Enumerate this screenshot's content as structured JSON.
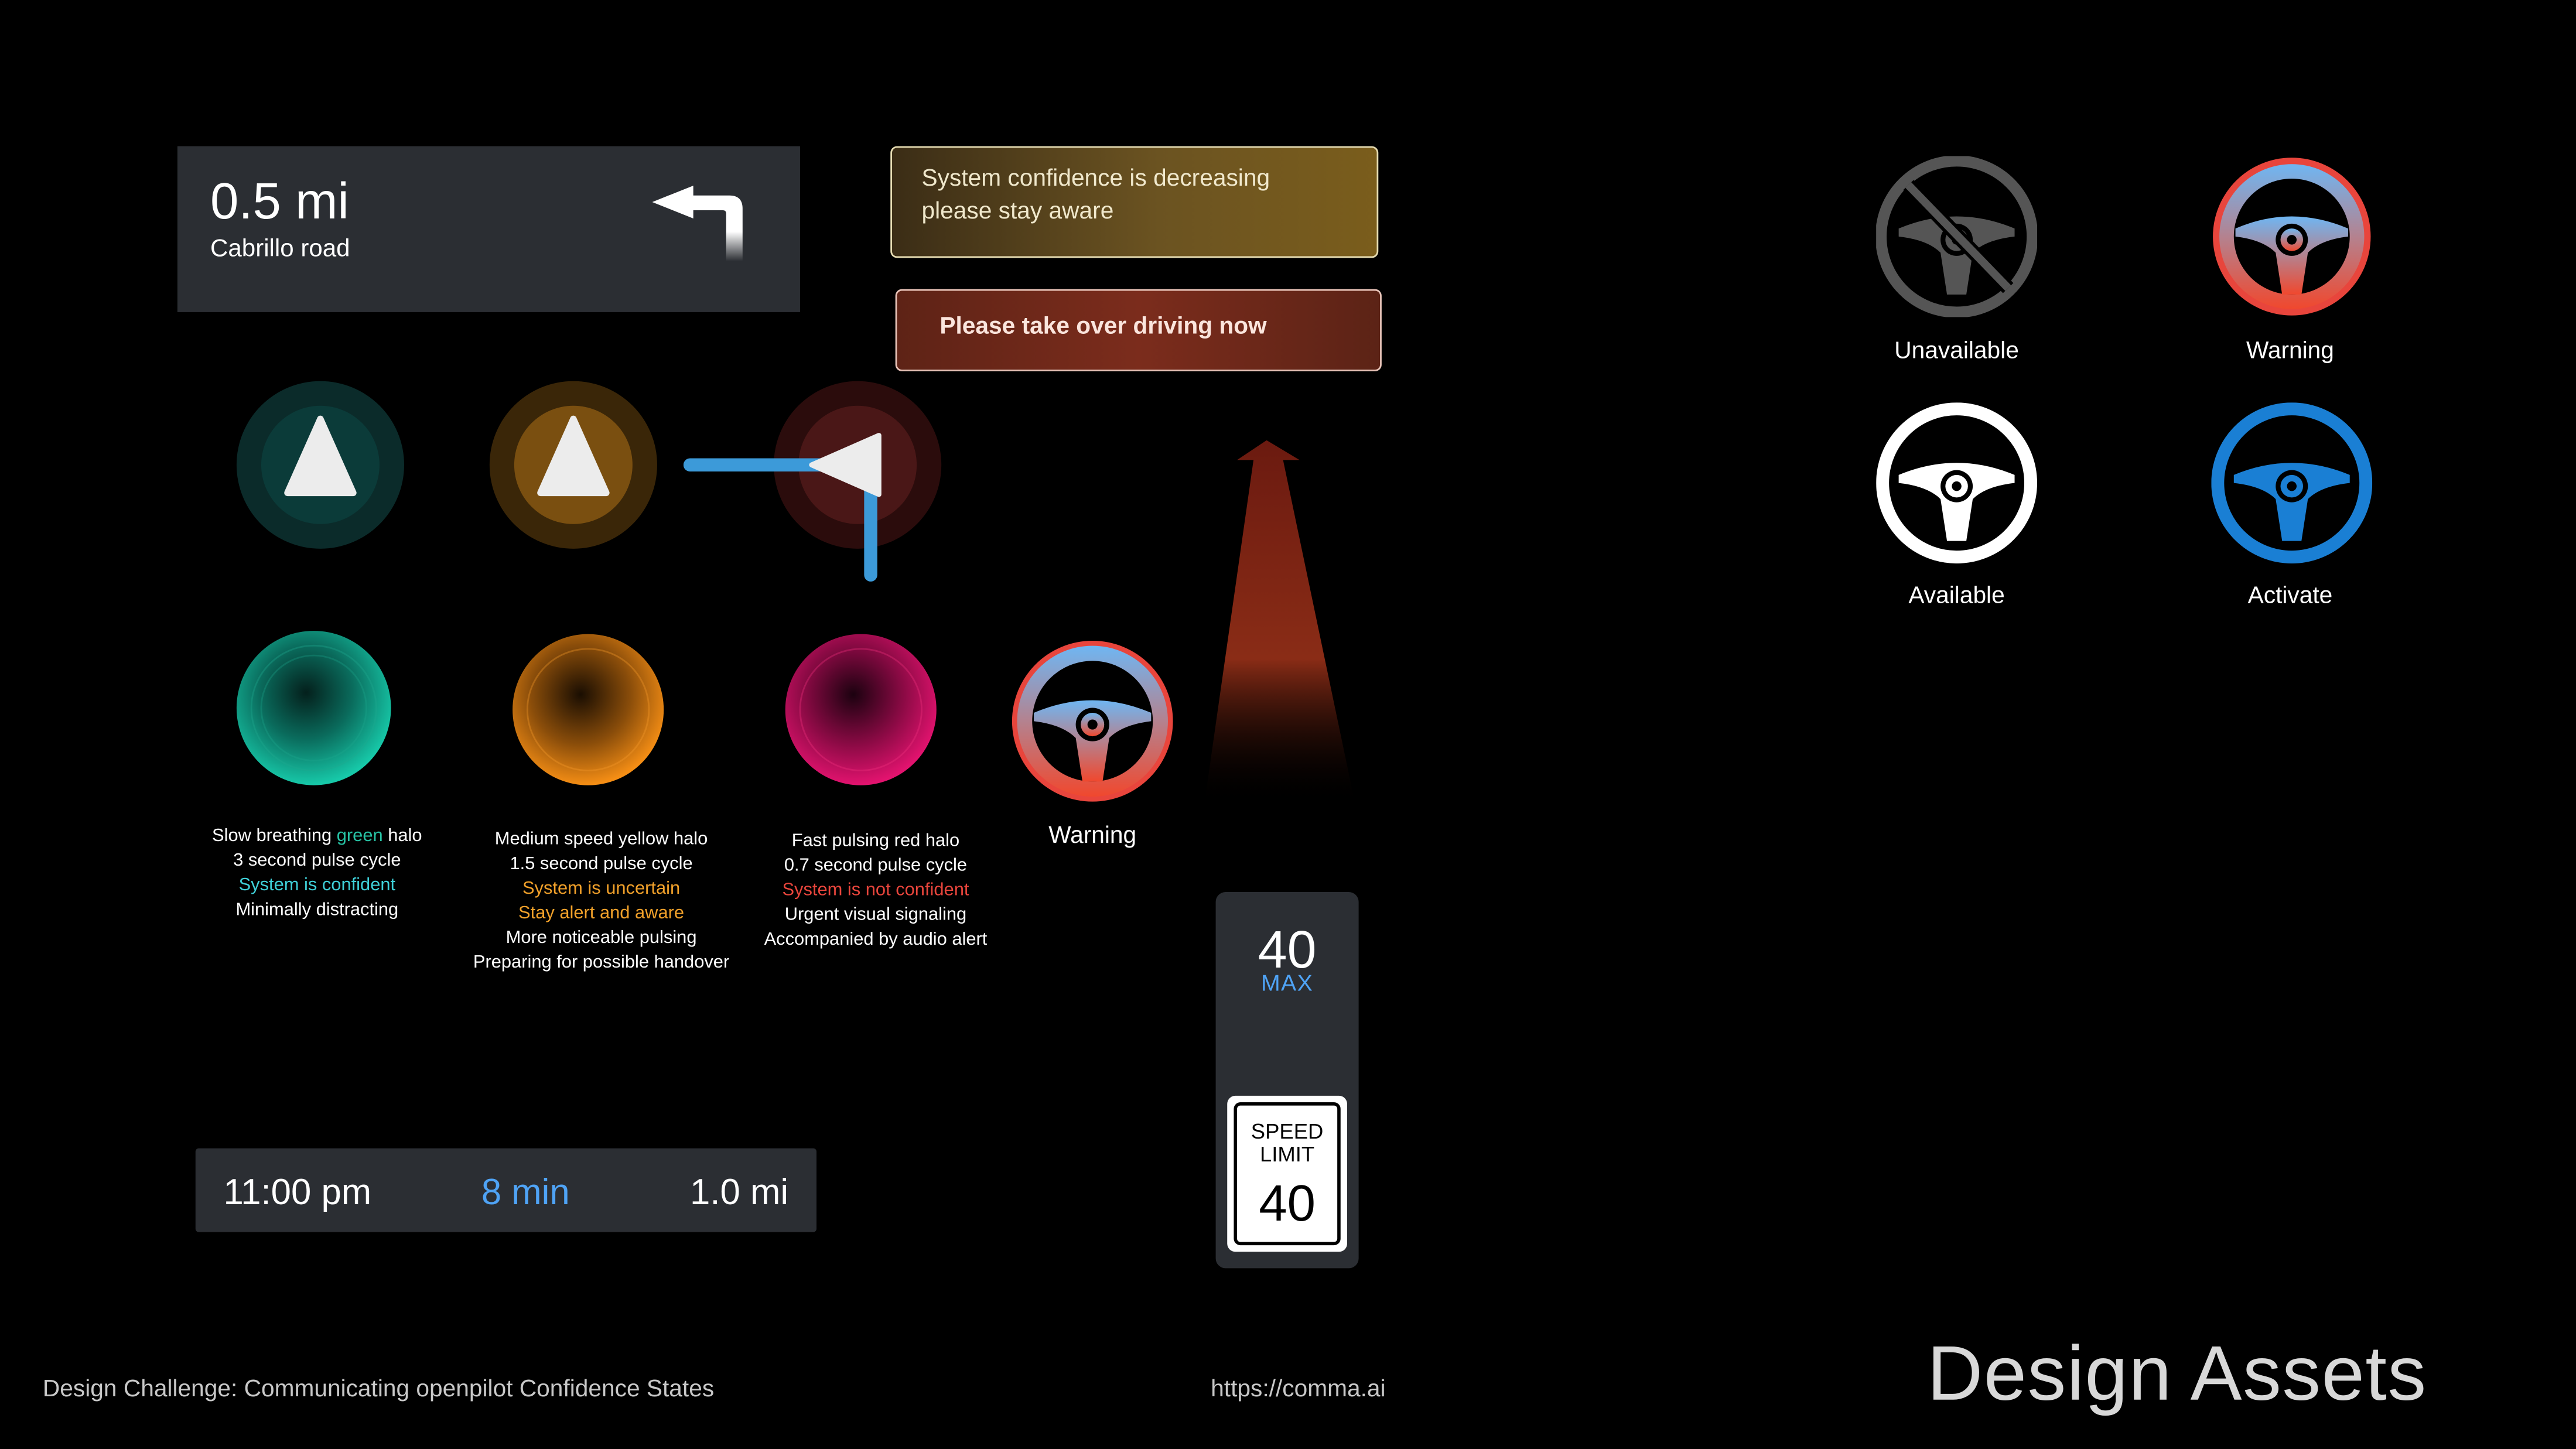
{
  "navigation": {
    "distance": "0.5 mi",
    "road": "Cabrillo road",
    "maneuver_icon": "turn-left-arrow-icon"
  },
  "banners": {
    "confidence_line1": "System confidence is decreasing",
    "confidence_line2": "please stay aware",
    "takeover": "Please take over driving now"
  },
  "halos": [
    {
      "color": "#12b59a",
      "caption": {
        "l1a": "Slow breathing ",
        "l1b": "green",
        "l1c": " halo",
        "l2": "3 second pulse cycle",
        "l3": "System is confident",
        "l4": "Minimally distracting"
      }
    },
    {
      "color": "#f08a12",
      "caption": {
        "l1": "Medium speed yellow halo",
        "l2": "1.5 second pulse cycle",
        "l3": "System is uncertain",
        "l4": "Stay alert and aware",
        "l5": "More noticeable pulsing",
        "l6": "Preparing for possible handover"
      }
    },
    {
      "color": "#e0126e",
      "caption": {
        "l1": "Fast pulsing red halo",
        "l2": "0.7 second pulse cycle",
        "l3": "System is not confident",
        "l4": "Urgent visual signaling",
        "l5": "Accompanied by audio alert"
      }
    }
  ],
  "warning_wheel_label": "Warning",
  "trip": {
    "arrival_time": "11:00 pm",
    "duration": "8 min",
    "remaining_distance": "1.0 mi"
  },
  "speed": {
    "max_value": "40",
    "max_label": "MAX",
    "sign_line1": "SPEED",
    "sign_line2": "LIMIT",
    "sign_value": "40"
  },
  "wheel_states": [
    {
      "label": "Unavailable",
      "color": "#555555"
    },
    {
      "label": "Warning",
      "color": "#e8453c"
    },
    {
      "label": "Available",
      "color": "#ffffff"
    },
    {
      "label": "Activate",
      "color": "#1a7fd4"
    }
  ],
  "footer": {
    "left": "Design Challenge: Communicating openpilot Confidence States",
    "url": "https://comma.ai",
    "title": "Design Assets"
  }
}
